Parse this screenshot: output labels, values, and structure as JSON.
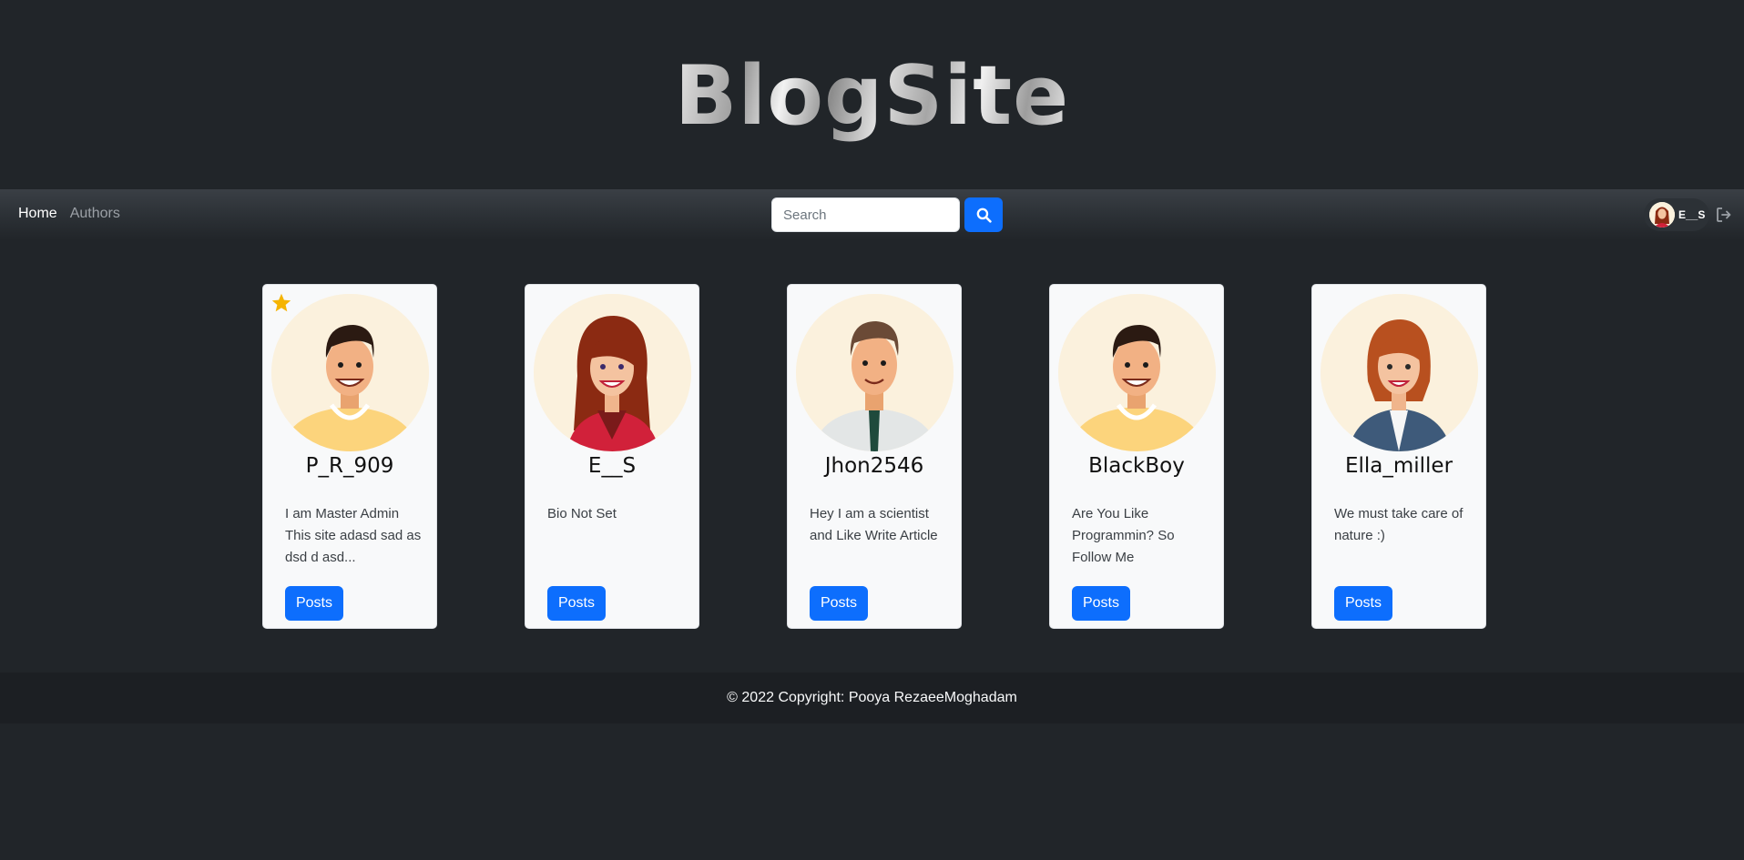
{
  "banner": {
    "title": "BlogSite"
  },
  "nav": {
    "links": [
      {
        "label": "Home",
        "active": true
      },
      {
        "label": "Authors",
        "active": false
      }
    ],
    "search": {
      "placeholder": "Search",
      "value": ""
    },
    "user": {
      "name": "E__S"
    }
  },
  "authors": [
    {
      "name": "P_R_909",
      "bio": "I am Master Admin This site adasd sad as dsd d asd...",
      "button": "Posts",
      "starred": true,
      "avatar": "man-smiling-yellow-shirt"
    },
    {
      "name": "E__S",
      "bio": "Bio Not Set",
      "button": "Posts",
      "starred": false,
      "avatar": "woman-red-hair"
    },
    {
      "name": "Jhon2546",
      "bio": "Hey I am a scientist and Like Write Article",
      "button": "Posts",
      "starred": false,
      "avatar": "man-shirt-tie"
    },
    {
      "name": "BlackBoy",
      "bio": "Are You Like Programmin? So Follow Me",
      "button": "Posts",
      "starred": false,
      "avatar": "man-smiling-yellow-shirt"
    },
    {
      "name": "Ella_miller",
      "bio": "We must take care of nature :)",
      "button": "Posts",
      "starred": false,
      "avatar": "woman-blue-jacket"
    }
  ],
  "footer": {
    "text": "© 2022 Copyright: Pooya RezaeeMoghadam"
  },
  "colors": {
    "background": "#212529",
    "primary": "#0d6efd",
    "card": "#f8f9fa",
    "avatar_bg": "#fbf1dd",
    "star": "#f5b400"
  }
}
